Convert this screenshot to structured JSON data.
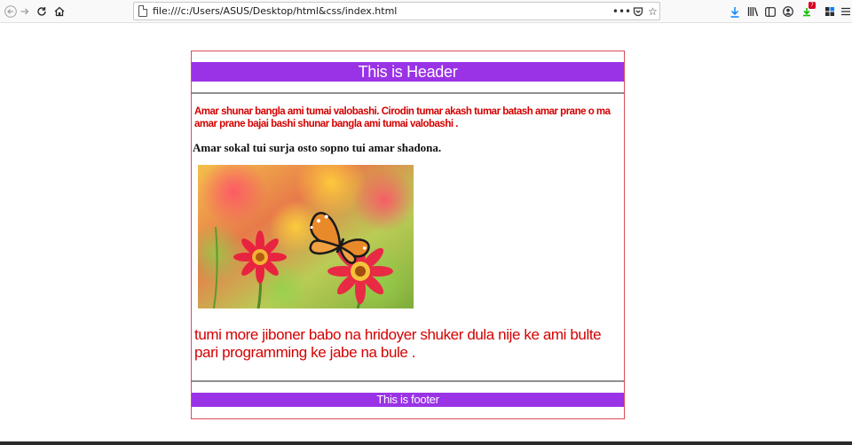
{
  "browser": {
    "url": "file:///c:/Users/ASUS/Desktop/html&css/index.html",
    "notification_count": "7",
    "icons": {
      "back": "back-arrow-icon",
      "forward": "forward-arrow-icon",
      "reload": "reload-icon",
      "home": "home-icon",
      "page": "page-icon",
      "more": "more-dots-icon",
      "pocket": "pocket-icon",
      "bookmark": "bookmark-star-icon",
      "downloads": "download-icon",
      "library": "library-icon",
      "sidebar": "sidebar-icon",
      "account": "account-icon",
      "extension": "extension-icon",
      "menu": "hamburger-menu-icon"
    }
  },
  "page": {
    "header": "This is Header",
    "paragraph_red": "Amar shunar bangla ami tumai valobashi. Cirodin tumar akash tumar batash amar prane o ma amar prane bajai bashi shunar bangla ami tumai valobashi .",
    "paragraph_bold": "Amar sokal tui surja osto sopno tui amar shadona.",
    "slogan": "tumi more jiboner babo na hridoyer shuker dula nije ke ami bulte pari programming ke jabe na bule .",
    "footer": "This is footer",
    "image_subject": "butterfly-on-flowers"
  },
  "colors": {
    "bar_purple": "#9a33e6",
    "text_red": "#d40000",
    "container_border": "#d94c5c"
  }
}
